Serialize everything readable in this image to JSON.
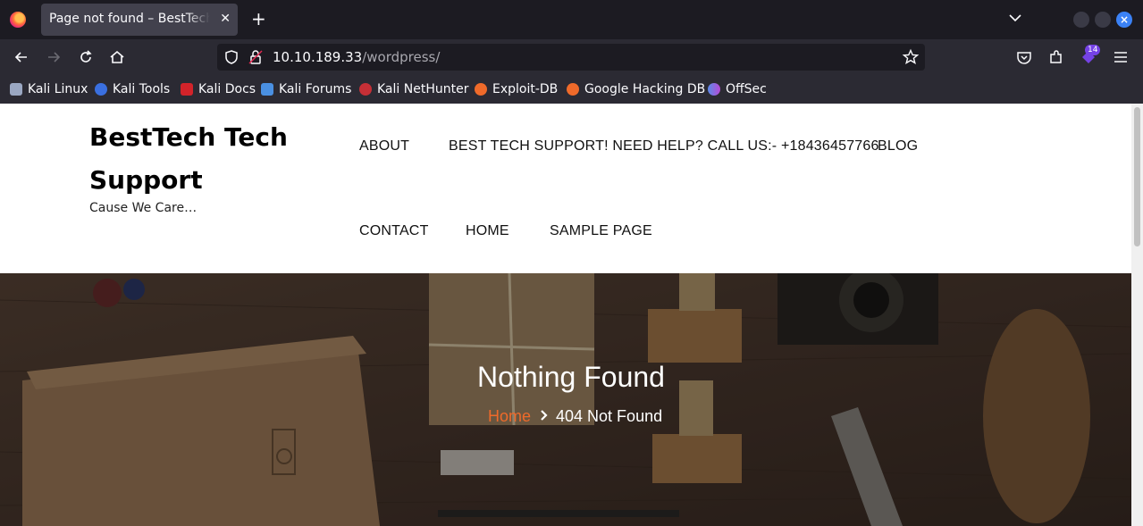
{
  "browser": {
    "tab_title": "Page not found – BestTech Tech Support",
    "close_glyph": "✕",
    "newtab_glyph": "+",
    "url_host": "10.10.189.33",
    "url_path": "/wordpress/",
    "extension_badge": "14",
    "bookmarks": [
      "Kali Linux",
      "Kali Tools",
      "Kali Docs",
      "Kali Forums",
      "Kali NetHunter",
      "Exploit-DB",
      "Google Hacking DB",
      "OffSec"
    ],
    "accent_color": "#7542e5"
  },
  "site": {
    "title": "BestTech Tech Support",
    "tagline": "Cause We Care…",
    "menu": [
      "ABOUT",
      "BEST TECH SUPPORT! NEED HELP? CALL US:- +18436457766",
      "BLOG",
      "CONTACT",
      "HOME",
      "SAMPLE PAGE"
    ]
  },
  "hero": {
    "heading": "Nothing Found",
    "breadcrumb_home": "Home",
    "breadcrumb_current": "404 Not Found",
    "link_color": "#ef6a2a"
  }
}
